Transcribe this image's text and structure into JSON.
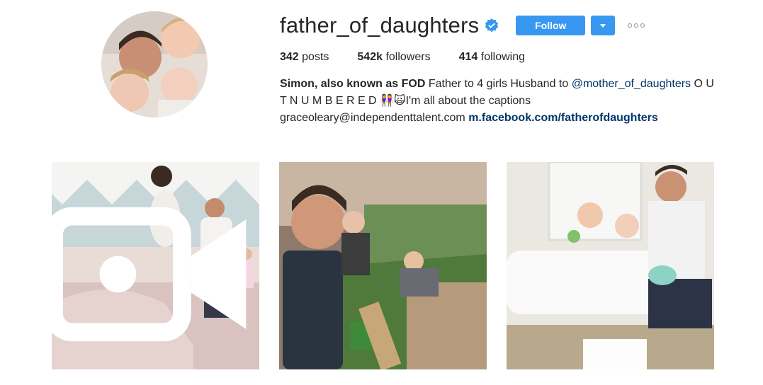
{
  "profile": {
    "username": "father_of_daughters",
    "verified": true,
    "follow_label": "Follow",
    "avatar_alt": "profile-photo"
  },
  "stats": {
    "posts_count": "342",
    "posts_label": "posts",
    "followers_count": "542k",
    "followers_label": "followers",
    "following_count": "414",
    "following_label": "following"
  },
  "bio": {
    "name": "Simon, also known as FOD",
    "text1": " Father to 4 girls Husband to ",
    "mention": "@mother_of_daughters",
    "text2": " O U T N U M B E R E D ",
    "emoji": "👭🙀",
    "text3": "I'm all about the captions",
    "email": "graceoleary@independenttalent.com ",
    "link": "m.facebook.com/fatherofdaughters"
  },
  "posts": [
    {
      "type": "video"
    },
    {
      "type": "image"
    },
    {
      "type": "image"
    }
  ],
  "colors": {
    "accent": "#3897f0",
    "link": "#003569",
    "text": "#262626"
  }
}
